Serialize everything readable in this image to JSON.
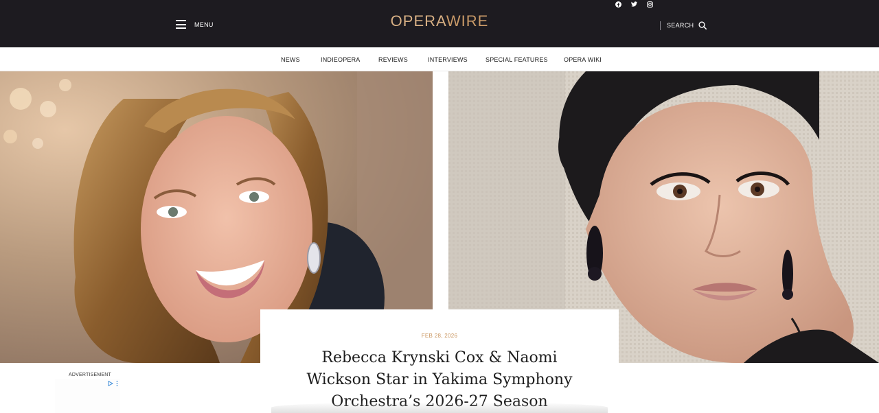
{
  "header": {
    "menu_label": "MENU",
    "logo_part1": "OPERA",
    "logo_part2": "WIRE",
    "search_label": "SEARCH",
    "social": [
      "facebook-icon",
      "twitter-icon",
      "instagram-icon"
    ]
  },
  "nav": {
    "items": [
      "NEWS",
      "INDIEOPERA",
      "REVIEWS",
      "INTERVIEWS",
      "SPECIAL FEATURES",
      "OPERA WIKI"
    ]
  },
  "article": {
    "date": "FEB 28, 2026",
    "title_lines": [
      "Rebecca Krynski Cox & Naomi",
      "Wickson Star in Yakima Symphony",
      "Orchestra’s 2026-27 Season"
    ]
  },
  "ad": {
    "label": "ADVERTISEMENT"
  },
  "colors": {
    "header_bg": "#1d1b20",
    "accent": "#c9955e",
    "logo": "#d6ab7d"
  }
}
